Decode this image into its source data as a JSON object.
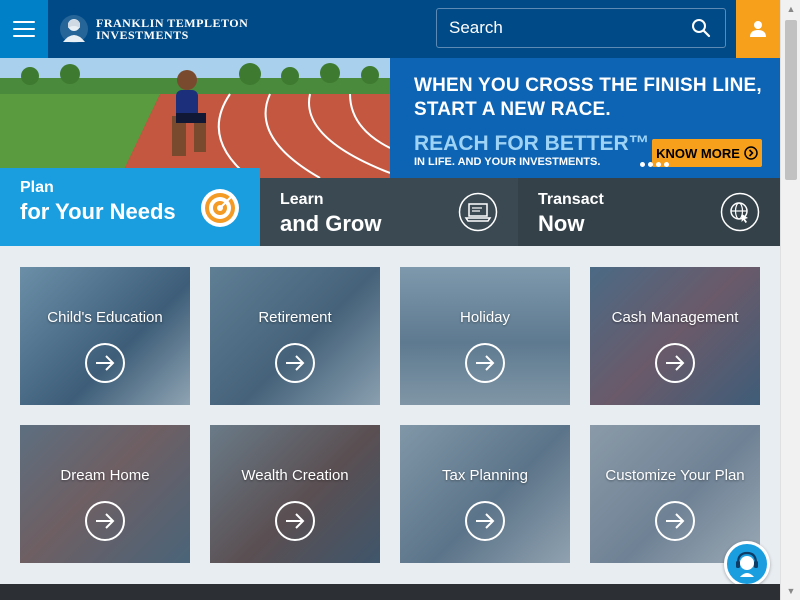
{
  "header": {
    "logo_line1": "FRANKLIN TEMPLETON",
    "logo_line2": "INVESTMENTS",
    "search_placeholder": "Search",
    "colors": {
      "bar": "#004b87",
      "menu": "#0080c6",
      "user": "#f7a01b"
    }
  },
  "hero": {
    "line1": "WHEN YOU CROSS THE FINISH LINE,",
    "line2": "START A NEW RACE.",
    "reach": "REACH FOR BETTER™",
    "tagline": "IN LIFE. AND YOUR INVESTMENTS.",
    "cta": "KNOW MORE"
  },
  "tabs": [
    {
      "line1": "Plan",
      "line2": "for Your Needs",
      "icon": "target-icon",
      "active": true
    },
    {
      "line1": "Learn",
      "line2": "and Grow",
      "icon": "laptop-icon",
      "active": false
    },
    {
      "line1": "Transact",
      "line2": "Now",
      "icon": "globe-cursor-icon",
      "active": false
    }
  ],
  "cards": [
    {
      "label": "Child's Education"
    },
    {
      "label": "Retirement"
    },
    {
      "label": "Holiday"
    },
    {
      "label": "Cash Management"
    },
    {
      "label": "Dream Home"
    },
    {
      "label": "Wealth Creation"
    },
    {
      "label": "Tax Planning"
    },
    {
      "label": "Customize Your Plan"
    }
  ]
}
